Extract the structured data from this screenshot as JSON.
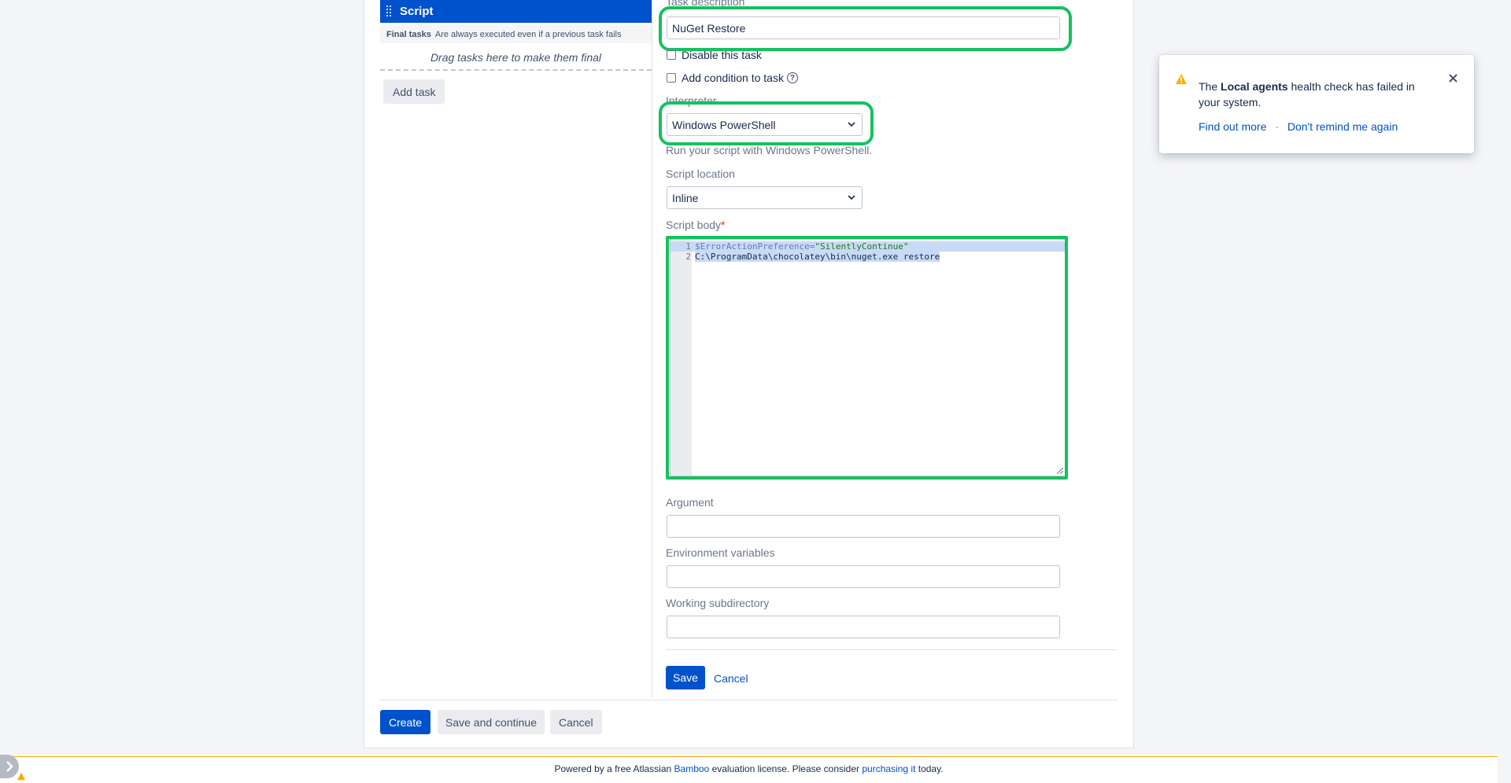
{
  "left_panel": {
    "task_name": "Script",
    "final_tasks_title": "Final tasks",
    "final_tasks_note": "Are always executed even if a previous task fails",
    "drag_hint": "Drag tasks here to make them final",
    "add_task_label": "Add task"
  },
  "form": {
    "task_description_label": "Task description",
    "task_description_value": "NuGet Restore",
    "disable_label": "Disable this task",
    "condition_label": "Add condition to task",
    "interpreter_label": "Interpreter",
    "interpreter_value": "Windows PowerShell",
    "interpreter_help": "Run your script with Windows PowerShell.",
    "script_location_label": "Script location",
    "script_location_value": "Inline",
    "script_body_label": "Script body",
    "required_mark": "*",
    "script_lines": [
      {
        "num": "1",
        "code": "$ErrorActionPreference=\"SilentlyContinue\""
      },
      {
        "num": "2",
        "code": "C:\\ProgramData\\chocolatey\\bin\\nuget.exe restore"
      }
    ],
    "argument_label": "Argument",
    "argument_value": "",
    "env_label": "Environment variables",
    "env_value": "",
    "workdir_label": "Working subdirectory",
    "workdir_value": "",
    "save_label": "Save",
    "cancel_label": "Cancel"
  },
  "bottom_buttons": {
    "create_label": "Create",
    "save_continue_label": "Save and continue",
    "cancel_label": "Cancel"
  },
  "toast": {
    "icon": "warning-icon",
    "text_prefix": "The ",
    "text_bold": "Local agents",
    "text_suffix": " health check has failed in your system.",
    "find_out_more": "Find out more",
    "separator": "·",
    "dont_remind": "Don't remind me again",
    "close_icon": "close-icon"
  },
  "footer": {
    "prefix": "Powered by a free Atlassian ",
    "bamboo_link": "Bamboo",
    "middle": " evaluation license. Please consider ",
    "purchase_link": "purchasing it",
    "suffix": " today."
  },
  "colors": {
    "accent": "#0052cc",
    "highlight": "#16c060",
    "warning": "#ffab00"
  }
}
